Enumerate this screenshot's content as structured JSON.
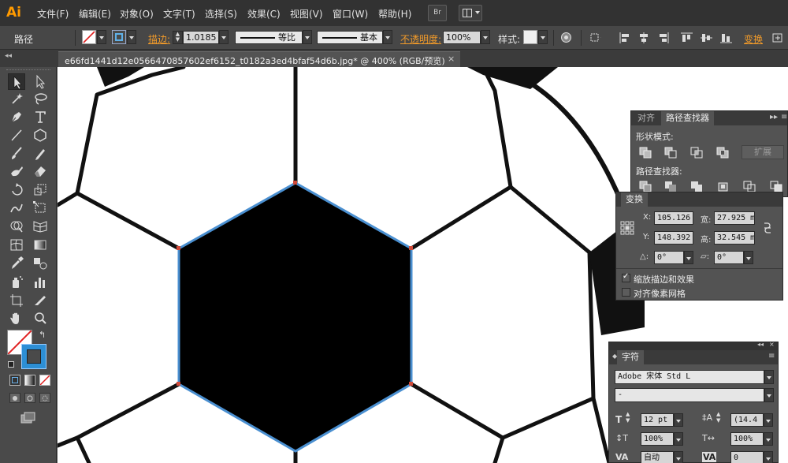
{
  "app": {
    "logo": "Ai"
  },
  "menu": {
    "items": [
      "文件(F)",
      "编辑(E)",
      "对象(O)",
      "文字(T)",
      "选择(S)",
      "效果(C)",
      "视图(V)",
      "窗口(W)",
      "帮助(H)"
    ],
    "bridge_label": "Br"
  },
  "control_bar": {
    "object_type": "路径",
    "stroke_label": "描边:",
    "stroke_weight": "1.0185",
    "profile_uniform": "等比",
    "brush_basic": "基本",
    "opacity_label": "不透明度:",
    "opacity_value": "100%",
    "style_label": "样式:",
    "transform_label": "变换"
  },
  "document": {
    "tab_title": "e66fd1441d12e0566470857602ef6152_t0182a3ed4bfaf54d6b.jpg*  @  400%  (RGB/预览)",
    "close_glyph": "×"
  },
  "panels": {
    "pathfinder": {
      "tabs": [
        "对齐",
        "路径查找器"
      ],
      "shape_modes_label": "形状模式:",
      "expand_label": "扩展",
      "pathfinders_label": "路径查找器:"
    },
    "transform": {
      "tab": "变换",
      "x_label": "X:",
      "x_value": "105.126",
      "y_label": "Y:",
      "y_value": "148.392",
      "w_label": "宽:",
      "w_value": "27.925 m",
      "h_label": "高:",
      "h_value": "32.545 m",
      "rotate_value": "0°",
      "shear_value": "0°",
      "scale_strokes_label": "缩放描边和效果",
      "scale_strokes_checked": true,
      "align_pixel_label": "对齐像素网格",
      "align_pixel_checked": false
    },
    "character": {
      "tab": "字符",
      "font_family": "Adobe 宋体 Std L",
      "font_style": "-",
      "font_size": "12 pt",
      "leading": "(14.4",
      "vscale": "100%",
      "hscale": "100%",
      "kerning": "自动",
      "tracking": "0"
    }
  },
  "colors": {
    "accent_orange": "#ff9a00",
    "selection_blue": "#4a8fd0",
    "fill_black": "#000000",
    "stroke_none_red": "#e02020"
  },
  "icons": [
    "bridge-icon",
    "arrange-icon",
    "stroke-none-swatch",
    "fill-swatch",
    "selection-tool-icon",
    "direct-selection-tool-icon",
    "magic-wand-icon",
    "lasso-icon",
    "pen-icon",
    "type-icon",
    "line-icon",
    "polygon-icon",
    "brush-icon",
    "pencil-icon",
    "blob-brush-icon",
    "eraser-icon",
    "rotate-icon",
    "scale-icon",
    "warp-icon",
    "free-transform-icon",
    "shape-builder-icon",
    "perspective-grid-icon",
    "mesh-icon",
    "gradient-icon",
    "eyedropper-icon",
    "blend-icon",
    "symbol-sprayer-icon",
    "graph-icon",
    "artboard-icon",
    "slice-icon",
    "hand-icon",
    "zoom-icon"
  ]
}
